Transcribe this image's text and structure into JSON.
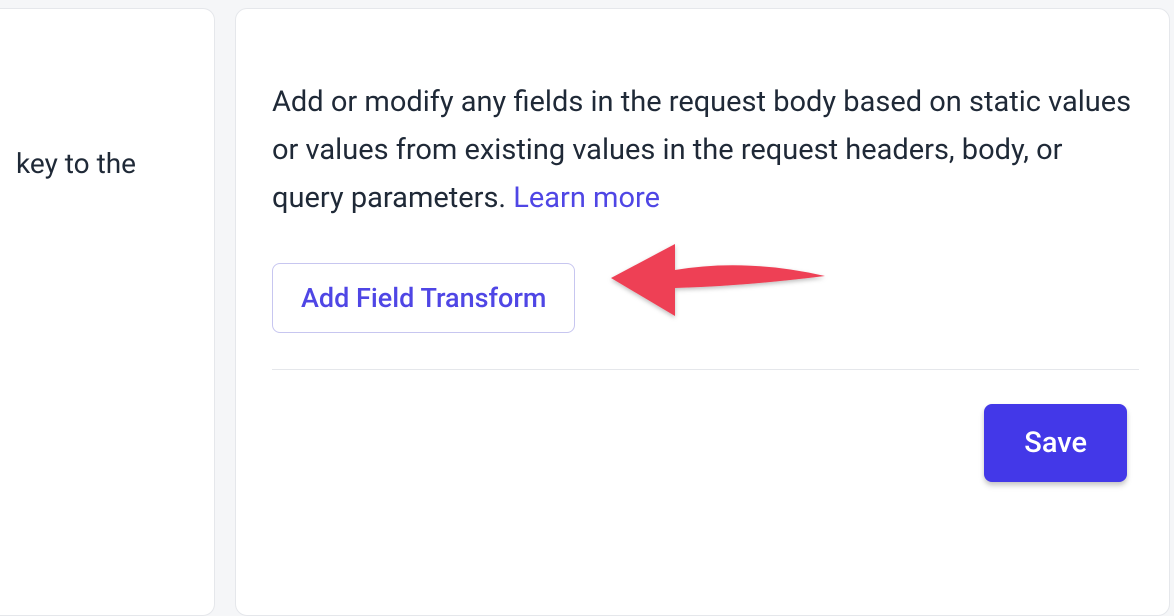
{
  "left_panel": {
    "text_fragment": "key to the"
  },
  "main": {
    "description_text": "Add or modify any fields in the request body based on static values or values from existing values in the request headers, body, or query parameters. ",
    "learn_more_label": "Learn more",
    "add_field_transform_label": "Add Field Transform",
    "save_label": "Save"
  }
}
